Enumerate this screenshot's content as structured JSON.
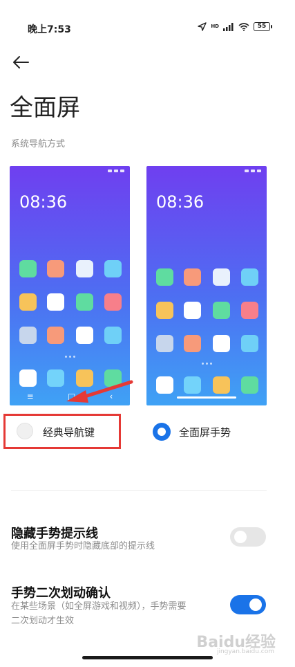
{
  "status_bar": {
    "time": "晚上7:53",
    "battery": "55",
    "signal_tag": "HD"
  },
  "page": {
    "title": "全面屏",
    "section_label": "系统导航方式"
  },
  "preview_classic": {
    "clock": "08:36"
  },
  "preview_gesture": {
    "clock": "08:36"
  },
  "icons": {
    "back": "back-arrow-icon",
    "menu": "menu-key-icon",
    "home": "home-key-icon",
    "back_key": "back-key-icon"
  },
  "options": {
    "classic": {
      "label": "经典导航键",
      "selected": false
    },
    "gesture": {
      "label": "全面屏手势",
      "selected": true
    }
  },
  "settings": {
    "hide_hint_line": {
      "title": "隐藏手势提示线",
      "subtitle": "使用全面屏手势时隐藏底部的提示线",
      "enabled": false
    },
    "double_swipe": {
      "title": "手势二次划动确认",
      "subtitle_line1": "在某些场景（如全屏游戏和视频），手势需要",
      "subtitle_line2": "二次划动才生效",
      "enabled": true
    }
  },
  "watermark": {
    "text": "Baidu经验",
    "sub": "jingyan.baidu.com"
  },
  "colors": {
    "accent": "#1a73e8",
    "highlight_box": "#e53935",
    "annotation_arrow": "#e53935"
  },
  "app_colors": [
    "#5fdca0",
    "#f79a7a",
    "#e9f1fc",
    "#6fd0f7",
    "#f7c35a",
    "#ffffff",
    "#5fdca0",
    "#f77f8a",
    "#c7d6ec",
    "#f79a7a",
    "#ffffff",
    "#6fd0f7"
  ],
  "dock_colors": [
    "#ffffff",
    "#73d3fa",
    "#f7c35a",
    "#5fdca0"
  ]
}
